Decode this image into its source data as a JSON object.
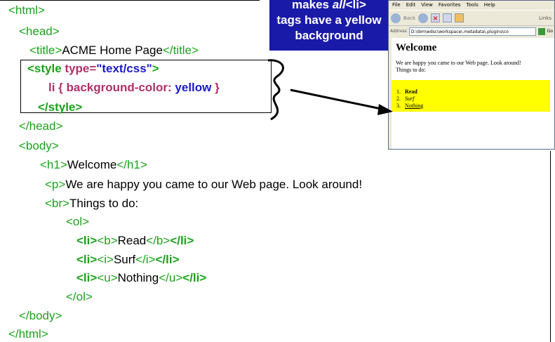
{
  "callout": {
    "line1_pre": "makes ",
    "line1_em": "all",
    "line1_tag": "<li>",
    "line2": "tags have a yellow",
    "line3": "background"
  },
  "code": {
    "html_open": "<html>",
    "head_open": "<head>",
    "title_open": "<title>",
    "title_text": "ACME Home Page",
    "title_close": "</title>",
    "style_open_lt": "<style ",
    "style_attr": "type=",
    "style_attr_val": "\"text/css\"",
    "style_open_gt": ">",
    "rule_selector": "li { background-color: ",
    "rule_value": "yellow",
    "rule_close": " }",
    "style_close": "</style>",
    "head_close": "</head>",
    "body_open": "<body>",
    "h1_open": "<h1>",
    "h1_text": "Welcome",
    "h1_close": "</h1>",
    "p_open": "<p>",
    "p_text": "We are happy you came to our Web page. Look around!",
    "br_open": "<br>",
    "br_text": "Things to do:",
    "ol_open": "<ol>",
    "li_open": "<li>",
    "li_close": "</li>",
    "b_open": "<b>",
    "b_text": "Read",
    "b_close": "</b>",
    "i_open": "<i>",
    "i_text": "Surf",
    "i_close": "</i>",
    "u_open": "<u>",
    "u_text": "Nothing",
    "u_close": "</u>",
    "ol_close": "</ol>",
    "body_close": "</body>",
    "html_close": "</html>"
  },
  "browser": {
    "menu": [
      "File",
      "Edit",
      "View",
      "Favorites",
      "Tools",
      "Help"
    ],
    "back_label": "Back",
    "links_label": "Links",
    "address_label": "Address",
    "address_value": "D:\\ibm\\wdsc\\workspace\\.metadata\\.plugins\\co",
    "go_label": "Go",
    "heading": "Welcome",
    "paragraph": "We are happy you came to our Web page. Look around!",
    "things": "Things to do:",
    "items": [
      {
        "num": "1.",
        "text": "Read"
      },
      {
        "num": "2.",
        "text": "Surf"
      },
      {
        "num": "3.",
        "text": "Nothing"
      }
    ]
  },
  "colors": {
    "tag": "#1aa31a",
    "keyword": "#b0306a",
    "value": "#1a1acc",
    "callout_bg": "#1a1aa8",
    "highlight": "#ffff00"
  }
}
